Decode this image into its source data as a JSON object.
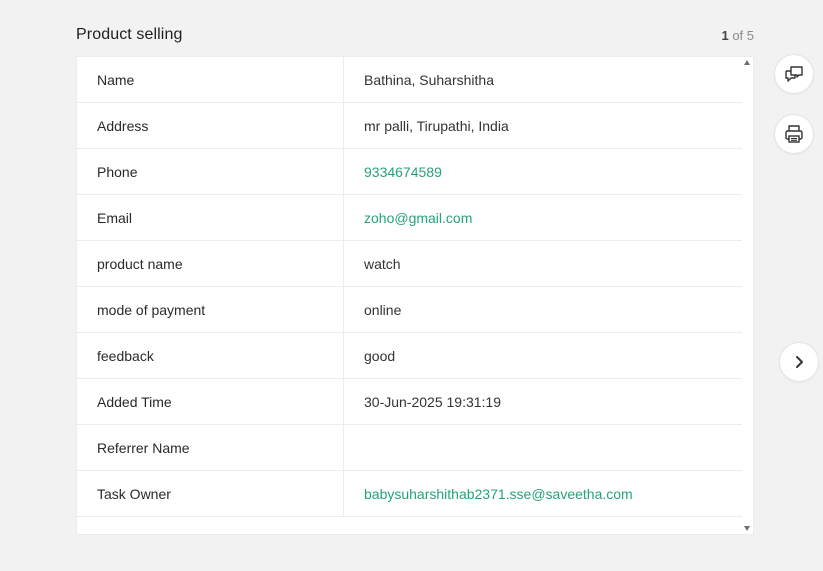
{
  "header": {
    "title": "Product selling",
    "pager_current": "1",
    "pager_rest": " of 5"
  },
  "record": {
    "rows": [
      {
        "label": "Name",
        "value": "Bathina, Suharshitha",
        "link": false
      },
      {
        "label": "Address",
        "value": "mr palli, Tirupathi, India",
        "link": false
      },
      {
        "label": "Phone",
        "value": "9334674589",
        "link": true
      },
      {
        "label": "Email",
        "value": "zoho@gmail.com",
        "link": true
      },
      {
        "label": "product name",
        "value": "watch",
        "link": false
      },
      {
        "label": "mode of payment",
        "value": "online",
        "link": false
      },
      {
        "label": "feedback",
        "value": "good",
        "link": false
      },
      {
        "label": "Added Time",
        "value": "30-Jun-2025 19:31:19",
        "link": false
      },
      {
        "label": "Referrer Name",
        "value": "",
        "link": false
      },
      {
        "label": "Task Owner",
        "value": "babysuharshithab2371.sse@saveetha.com",
        "link": true
      }
    ]
  },
  "side_actions": {
    "comment_icon": "comment-bubbles-icon",
    "print_icon": "printer-icon",
    "next_icon": "chevron-right-icon"
  },
  "colors": {
    "link": "#26a27b",
    "background": "#f2f2f2"
  }
}
